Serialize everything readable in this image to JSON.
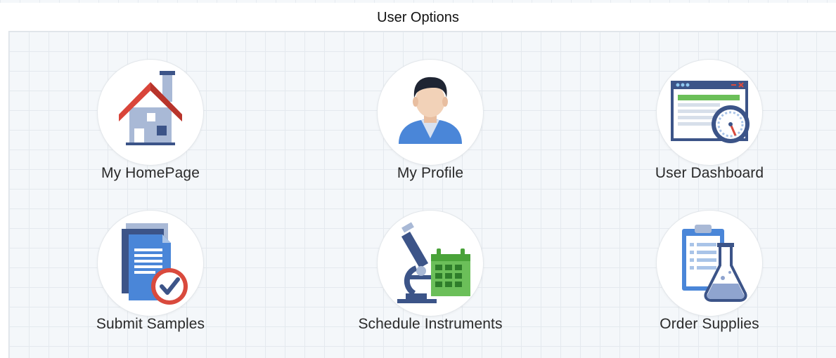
{
  "panel": {
    "title": "User Options"
  },
  "options": [
    {
      "label": "My HomePage",
      "icon": "house-icon"
    },
    {
      "label": "My Profile",
      "icon": "user-avatar-icon"
    },
    {
      "label": "User Dashboard",
      "icon": "dashboard-gauge-icon"
    },
    {
      "label": "Submit Samples",
      "icon": "documents-check-icon"
    },
    {
      "label": "Schedule Instruments",
      "icon": "microscope-calendar-icon"
    },
    {
      "label": "Order Supplies",
      "icon": "clipboard-flask-icon"
    }
  ],
  "colors": {
    "roof": "#d9453a",
    "house_wall": "#a9b9d6",
    "navy": "#3c5488",
    "skin": "#f2d2b8",
    "shirt": "#4a86d8",
    "green": "#6bbf59",
    "check_red": "#d94a3d",
    "flask_fill": "#8fa4cf"
  }
}
